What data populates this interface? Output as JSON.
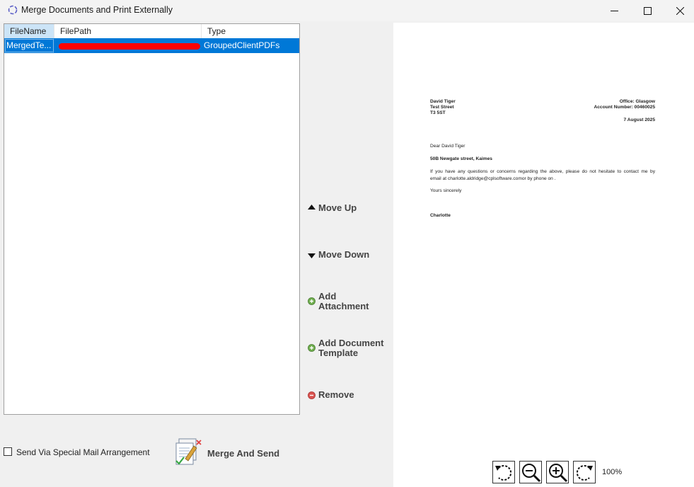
{
  "window": {
    "title": "Merge Documents and Print Externally",
    "icon": "app-ring-icon",
    "controls": [
      "minimize-icon",
      "maximize-icon",
      "close-icon"
    ]
  },
  "list": {
    "columns": [
      "FileName",
      "FilePath",
      "Type"
    ],
    "rows": [
      {
        "filename": "MergedTe...",
        "filepath": "",
        "type": "GroupedClientPDFs"
      }
    ]
  },
  "actions": {
    "move_up": "Move Up",
    "move_down": "Move Down",
    "add_attachment_1": "Add",
    "add_attachment_2": "Attachment",
    "add_template_1": "Add Document",
    "add_template_2": "Template",
    "remove": "Remove"
  },
  "footer": {
    "special_mail": "Send Via Special Mail Arrangement",
    "special_mail_checked": false,
    "merge_send": "Merge And Send"
  },
  "preview": {
    "name": "David Tiger",
    "street": "Test Street",
    "postcode": "T3 5ST",
    "office": "Office: Glasgow",
    "account": "Account Number: 00460025",
    "date": "7 August 2025",
    "salutation": "Dear David Tiger",
    "subject": "50B Newgate street, Kaimes",
    "body_1": "If you have any questions or concerns regarding the above, please do not hesitate to contact me by",
    "body_2": "email at charlotte.aldridge@cplsoftware.comor by phone on .",
    "closing": "Yours sincerely",
    "signature": "Charlotte",
    "zoom": "100%"
  },
  "colors": {
    "selection": "#0078d7",
    "header_selected": "#cce4f7",
    "redaction": "#ff0000"
  }
}
